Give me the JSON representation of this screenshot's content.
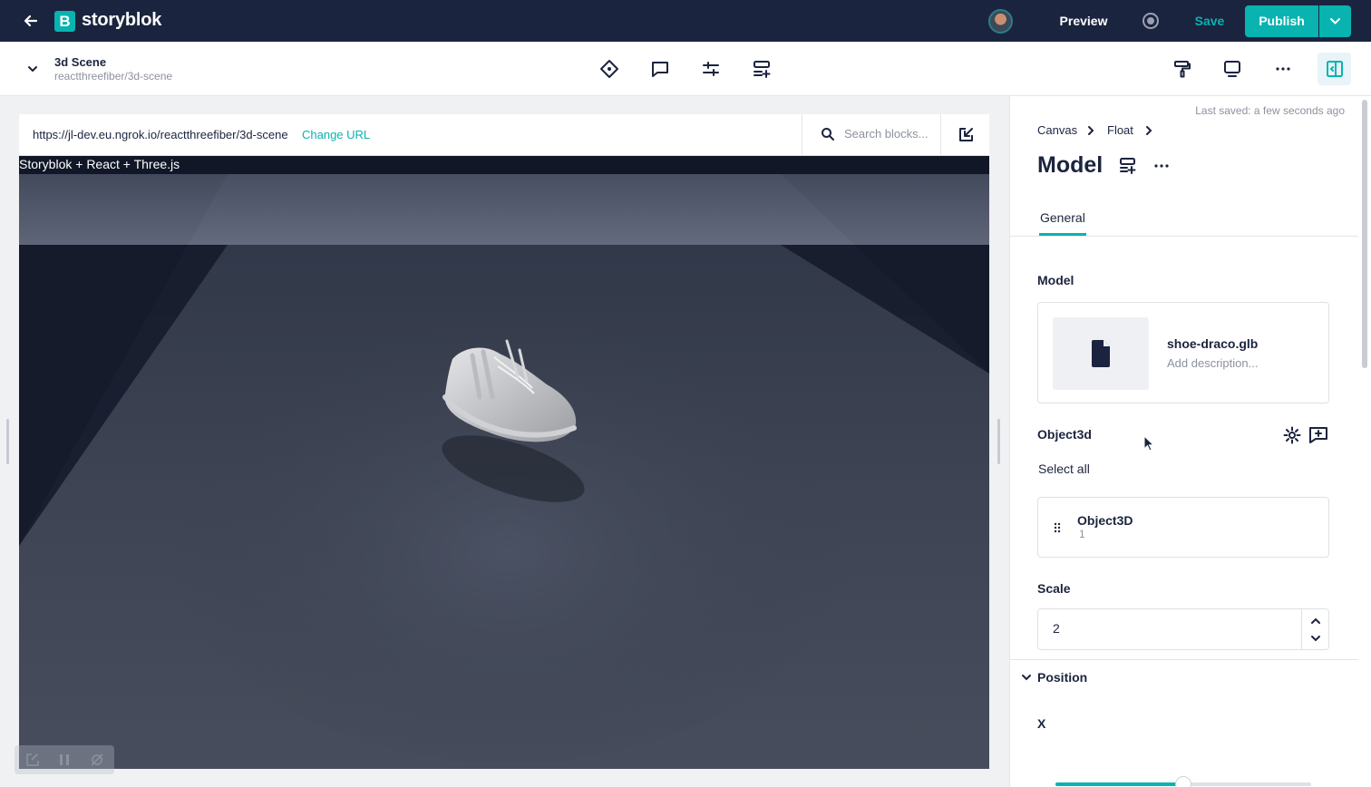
{
  "topbar": {
    "logo_mark": "B",
    "logo_text": "storyblok",
    "preview_label": "Preview",
    "save_label": "Save",
    "publish_label": "Publish",
    "icons": [
      "back-arrow-icon",
      "record-icon",
      "chevron-down-icon"
    ]
  },
  "story": {
    "title": "3d Scene",
    "slug": "reactthreefiber/3d-scene"
  },
  "toolbar": {
    "icons": [
      "diamond-icon",
      "comment-icon",
      "sliders-icon",
      "add-block-icon",
      "paint-roller-icon",
      "screen-icon",
      "more-icon",
      "sidebar-toggle-icon"
    ]
  },
  "preview": {
    "url": "https://jl-dev.eu.ngrok.io/reactthreefiber/3d-scene",
    "change_url_label": "Change URL",
    "search_placeholder": "Search blocks...",
    "scene_title": "Storyblok + React + Three.js"
  },
  "panel": {
    "last_saved": "Last saved: a few seconds ago",
    "breadcrumb": [
      "Canvas",
      "Float"
    ],
    "title": "Model",
    "tabs": [
      "General"
    ],
    "model_label": "Model",
    "asset": {
      "name": "shoe-draco.glb",
      "description_placeholder": "Add description..."
    },
    "object3d_label": "Object3d",
    "select_all_label": "Select all",
    "object_item": {
      "name": "Object3D",
      "count": "1"
    },
    "scale_label": "Scale",
    "scale_value": "2",
    "position_label": "Position",
    "x_label": "X",
    "x_slider_fraction": 0.5
  },
  "colors": {
    "brand": "#09b3af",
    "topbar": "#1b243f"
  }
}
